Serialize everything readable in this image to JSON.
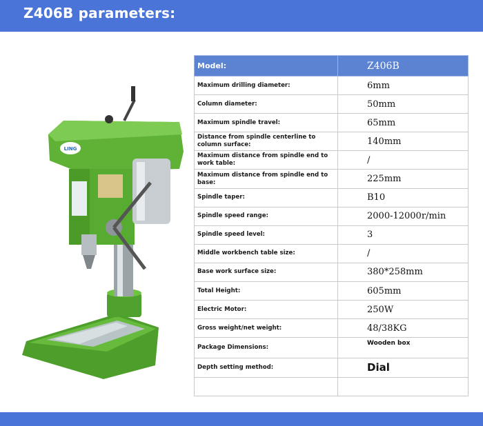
{
  "header": {
    "title": "Z406B parameters:"
  },
  "product": {
    "name": "drill-press",
    "brand_badge": "LING",
    "color": "#5fb236"
  },
  "specs": {
    "header_label": "Model:",
    "header_value": "Z406B",
    "rows": [
      {
        "label": "Maximum drilling diameter:",
        "value": "6mm"
      },
      {
        "label": "Column diameter:",
        "value": "50mm"
      },
      {
        "label": "Maximum spindle travel:",
        "value": "65mm"
      },
      {
        "label": "Distance from spindle centerline to column surface:",
        "value": "140mm"
      },
      {
        "label": "Maximum distance from spindle end to work table:",
        "value": "/"
      },
      {
        "label": "Maximum distance from spindle end to base:",
        "value": "225mm"
      },
      {
        "label": "Spindle taper:",
        "value": "B10"
      },
      {
        "label": "Spindle speed range:",
        "value": "2000-12000r/min"
      },
      {
        "label": "Spindle speed level:",
        "value": "3"
      },
      {
        "label": "Middle workbench table size:",
        "value": "/"
      },
      {
        "label": "Base work surface size:",
        "value": "380*258mm"
      },
      {
        "label": "Total Height:",
        "value": "605mm"
      },
      {
        "label": "Electric Motor:",
        "value": "250W"
      },
      {
        "label": "Gross weight/net weight:",
        "value": "48/38KG"
      },
      {
        "label": "Package Dimensions:",
        "value": "Wooden box"
      },
      {
        "label": "Depth setting method:",
        "value": "Dial"
      },
      {
        "label": "",
        "value": ""
      }
    ]
  },
  "colors": {
    "accent": "#4a74d8",
    "table_header": "#5b83d2"
  }
}
